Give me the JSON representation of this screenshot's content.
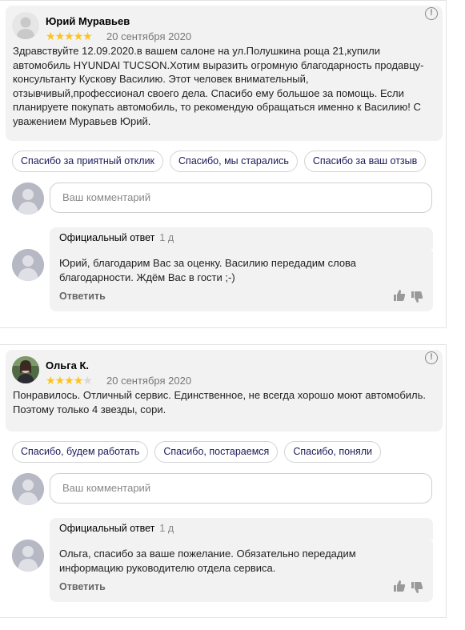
{
  "reviews": [
    {
      "author": "Юрий Муравьев",
      "rating": 5,
      "date": "20 сентября 2020",
      "text": "Здравствуйте 12.09.2020.в вашем салоне на ул.Полушкина роща 21,купили автомобиль HYUNDAI TUCSON.Хотим выразить огромную благодарность продавцу-консультанту Кускову Василию. Этот человек внимательный, отзывчивый,профессионал своего дела. Спасибо ему большое за помощь. Если планируете покупать автомобиль, то рекомендую обращаться именно к Василию! С уважением Муравьев Юрий.",
      "quick_replies": [
        "Спасибо за приятный отклик",
        "Спасибо, мы старались",
        "Спасибо за ваш отзыв"
      ],
      "comment_placeholder": "Ваш комментарий",
      "official_label": "Официальный ответ",
      "official_ago": "1 д",
      "official_text": "Юрий, благодарим Вас за оценку. Василию передадим слова благодарности. Ждём Вас в гости ;-)",
      "reply_label": "Ответить"
    },
    {
      "author": "Ольга К.",
      "rating": 4,
      "date": "20 сентября 2020",
      "text": "Понравилось. Отличный сервис. Единственное, не всегда хорошо моют автомобиль. Поэтому только 4 звезды, сори.",
      "quick_replies": [
        "Спасибо, будем работать",
        "Спасибо, постараемся",
        "Спасибо, поняли"
      ],
      "comment_placeholder": "Ваш комментарий",
      "official_label": "Официальный ответ",
      "official_ago": "1 д",
      "official_text": "Ольга, спасибо за ваше пожелание. Обязательно передадим информацию руководителю отдела сервиса.",
      "reply_label": "Ответить"
    }
  ],
  "icons": {
    "info": "!",
    "star": "★"
  },
  "colors": {
    "star_on": "#fcc31f",
    "star_off": "#d8d8d8",
    "panel_bg": "#f2f2f2",
    "chip_text": "#1a1a5a"
  }
}
